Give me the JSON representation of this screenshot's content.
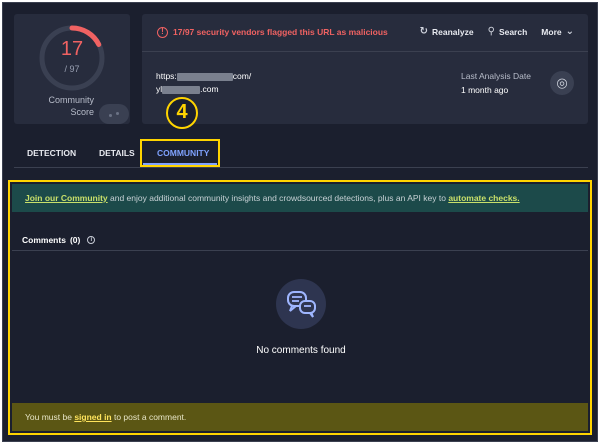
{
  "score": {
    "detected": "17",
    "total": "/ 97",
    "label_line1": "Community",
    "label_line2": "Score",
    "fraction": 0.175
  },
  "header": {
    "alert": "17/97 security vendors flagged this URL as malicious",
    "actions": [
      {
        "label": "Reanalyze",
        "icon": "refresh-icon"
      },
      {
        "label": "Search",
        "icon": "search-icon"
      },
      {
        "label": "More",
        "icon": "chevron-down-icon"
      }
    ],
    "url_line1_prefix": "https:",
    "url_line1_suffix": "com/",
    "url_line2_prefix": "yl",
    "url_line2_suffix": ".com",
    "last_analysis_label": "Last Analysis Date",
    "last_analysis_value": "1 month ago"
  },
  "callout": "4",
  "tabs": [
    {
      "label": "DETECTION"
    },
    {
      "label": "DETAILS"
    },
    {
      "label": "COMMUNITY",
      "active": true
    }
  ],
  "community": {
    "banner_link1": "Join our Community",
    "banner_text": " and enjoy additional community insights and crowdsourced detections, plus an API key to ",
    "banner_link2": "automate checks.",
    "comments_label": "Comments",
    "comments_count": "(0)",
    "empty_text": "No comments found",
    "signin_prefix": "You must be ",
    "signin_link": "signed in",
    "signin_suffix": " to post a comment."
  },
  "colors": {
    "accent": "#7fa2ff",
    "danger": "#f06262",
    "highlight": "#ffd400"
  }
}
